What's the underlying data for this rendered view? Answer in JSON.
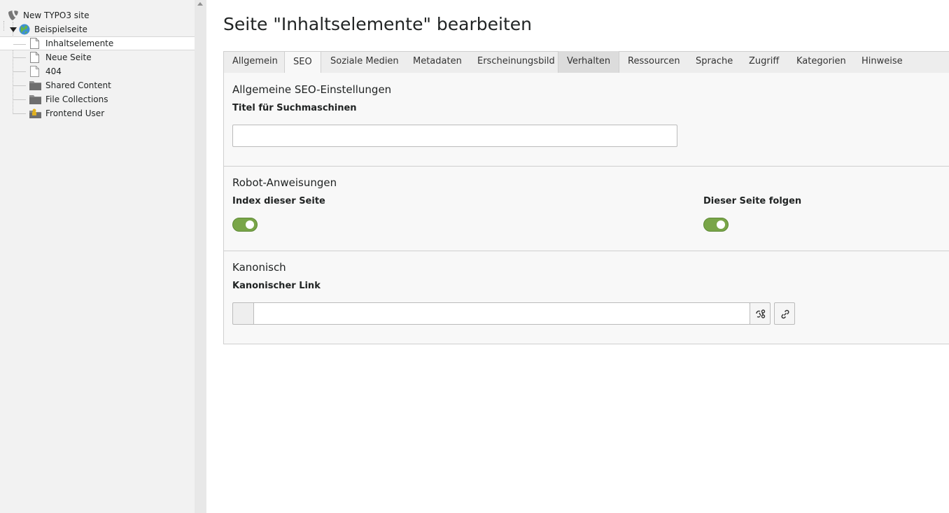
{
  "tree": {
    "items": [
      {
        "label": "New TYPO3 site",
        "icon": "typo3-logo-icon"
      },
      {
        "label": "Beispielseite",
        "icon": "globe-icon"
      },
      {
        "label": "Inhaltselemente",
        "icon": "page-icon",
        "selected": true
      },
      {
        "label": "Neue Seite",
        "icon": "page-icon"
      },
      {
        "label": "404",
        "icon": "page-icon"
      },
      {
        "label": "Shared Content",
        "icon": "folder-icon"
      },
      {
        "label": "File Collections",
        "icon": "folder-icon"
      },
      {
        "label": "Frontend User",
        "icon": "user-folder-icon"
      }
    ]
  },
  "header": {
    "title": "Seite \"Inhaltselemente\" bearbeiten"
  },
  "tabs": [
    {
      "label": "Allgemein"
    },
    {
      "label": "SEO",
      "active": true
    },
    {
      "label": "Soziale Medien"
    },
    {
      "label": "Metadaten"
    },
    {
      "label": "Erscheinungsbild"
    },
    {
      "label": "Verhalten",
      "hover": true
    },
    {
      "label": "Ressourcen"
    },
    {
      "label": "Sprache"
    },
    {
      "label": "Zugriff"
    },
    {
      "label": "Kategorien"
    },
    {
      "label": "Hinweise"
    }
  ],
  "seo": {
    "general": {
      "title": "Allgemeine SEO-Einstellungen",
      "seo_title_label": "Titel für Suchmaschinen",
      "seo_title_value": ""
    },
    "robots": {
      "title": "Robot-Anweisungen",
      "index_label": "Index dieser Seite",
      "index_enabled": true,
      "follow_label": "Dieser Seite folgen",
      "follow_enabled": true
    },
    "canonical": {
      "title": "Kanonisch",
      "link_label": "Kanonischer Link",
      "link_value": ""
    }
  },
  "colors": {
    "toggle_on": "#79a548",
    "tree_bg": "#f2f2f2",
    "panel_bg": "#f8f8f8"
  }
}
